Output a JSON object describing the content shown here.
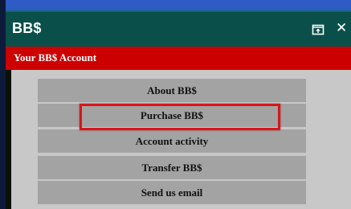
{
  "window": {
    "title": "BB$",
    "restore_icon": "restore-window-icon",
    "close_icon": "close-icon",
    "close_glyph": "✕"
  },
  "account_bar": {
    "label": "Your BB$ Account"
  },
  "menu": {
    "items": [
      {
        "label": "About BB$"
      },
      {
        "label": "Purchase BB$",
        "highlighted": true
      },
      {
        "label": "Account activity"
      },
      {
        "label": "Transfer BB$"
      },
      {
        "label": "Send us email"
      }
    ]
  },
  "colors": {
    "titlebar": "#0b4f4b",
    "account_bar": "#cc0000",
    "content_bg": "#c8c8c8",
    "menu_item_bg": "#a3a3a3",
    "highlight_border": "#d8151a"
  }
}
